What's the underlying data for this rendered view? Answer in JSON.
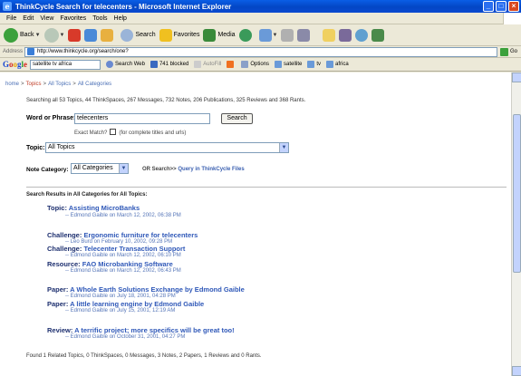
{
  "window": {
    "title": "ThinkCycle Search for telecenters - Microsoft Internet Explorer"
  },
  "menu": [
    "File",
    "Edit",
    "View",
    "Favorites",
    "Tools",
    "Help"
  ],
  "toolbar": {
    "back": "Back",
    "search": "Search",
    "favorites": "Favorites",
    "media": "Media"
  },
  "address": {
    "label": "Address",
    "url": "http://www.thinkcycle.org/search/one?",
    "go": "Go"
  },
  "googlebar": {
    "query": "satellite tv africa",
    "search_web": "Search Web",
    "blocked": "741 blocked",
    "autofill": "AutoFill",
    "options": "Options",
    "terms": [
      "satellite",
      "tv",
      "africa"
    ]
  },
  "breadcrumb": [
    "home",
    "Topics",
    "All Topics",
    "All Categories"
  ],
  "stats": "Searching all 53 Topics, 44 ThinkSpaces, 267 Messages, 732 Notes, 206 Publications, 325 Reviews and 368 Rants.",
  "form": {
    "word_label": "Word or Phrase:",
    "word_value": "telecenters",
    "search_button": "Search",
    "exact_label": "Exact Match?",
    "exact_hint": "(for complete titles and urls)",
    "topic_label": "Topic:",
    "topic_value": "All Topics",
    "note_label": "Note Category:",
    "note_value": "All Categories",
    "or_search": "OR Search>>",
    "or_search_link": "Query in ThinkCycle Files"
  },
  "results_heading": "Search Results in All Categories for All Topics:",
  "results": [
    {
      "kind": "Topic:",
      "title": "Assisting MicroBanks",
      "meta": "-- Edmond Gaible on March 12, 2002, 06:38 PM"
    },
    {
      "kind": "Challenge:",
      "title": "Ergonomic furniture for telecenters",
      "meta": "-- Leo Burd on February 10, 2002, 09:28 PM"
    },
    {
      "kind": "Challenge:",
      "title": "Telecenter Transaction Support",
      "meta": "-- Edmond Gaible on March 12, 2002, 06:10 PM"
    },
    {
      "kind": "Resource:",
      "title": "FAO Microbanking Software",
      "meta": "-- Edmond Gaible on March 12, 2002, 06:43 PM"
    },
    {
      "kind": "Paper:",
      "title": "A Whole Earth Solutions Exchange by Edmond Gaible",
      "meta": "-- Edmond Gaible on July 18, 2001, 04:28 PM"
    },
    {
      "kind": "Paper:",
      "title": "A little learning engine by Edmond Gaible",
      "meta": "-- Edmond Gaible on July 15, 2001, 12:19 AM"
    },
    {
      "kind": "Review:",
      "title": "A terrific project; more specifics will be great too!",
      "meta": "-- Edmond Gaible on October 31, 2001, 04:27 PM"
    }
  ],
  "summary": "Found 1 Related Topics, 0 ThinkSpaces, 0 Messages, 3 Notes, 2 Papers, 1 Reviews and 0 Rants."
}
